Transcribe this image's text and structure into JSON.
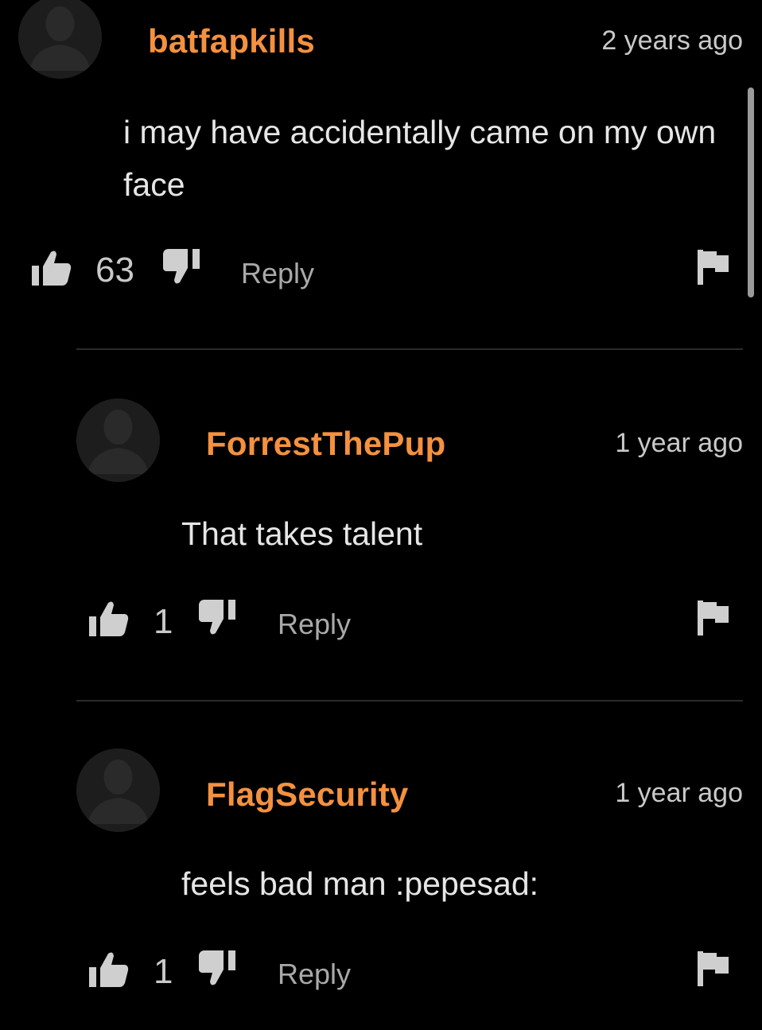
{
  "comments": [
    {
      "username": "batfapkills",
      "timestamp": "2 years ago",
      "text": "i may have accidentally came on my own face",
      "likes": "63",
      "reply_label": "Reply"
    },
    {
      "username": "ForrestThePup",
      "timestamp": "1 year ago",
      "text": "That takes talent",
      "likes": "1",
      "reply_label": "Reply"
    },
    {
      "username": "FlagSecurity",
      "timestamp": "1 year ago",
      "text": "feels bad man :pepesad:",
      "likes": "1",
      "reply_label": "Reply"
    }
  ],
  "colors": {
    "background": "#000000",
    "username": "#f4913f",
    "text": "#e6e6e6",
    "muted": "#a9a9a9"
  },
  "icons": [
    "avatar-icon",
    "thumbs-up-icon",
    "thumbs-down-icon",
    "flag-icon"
  ]
}
